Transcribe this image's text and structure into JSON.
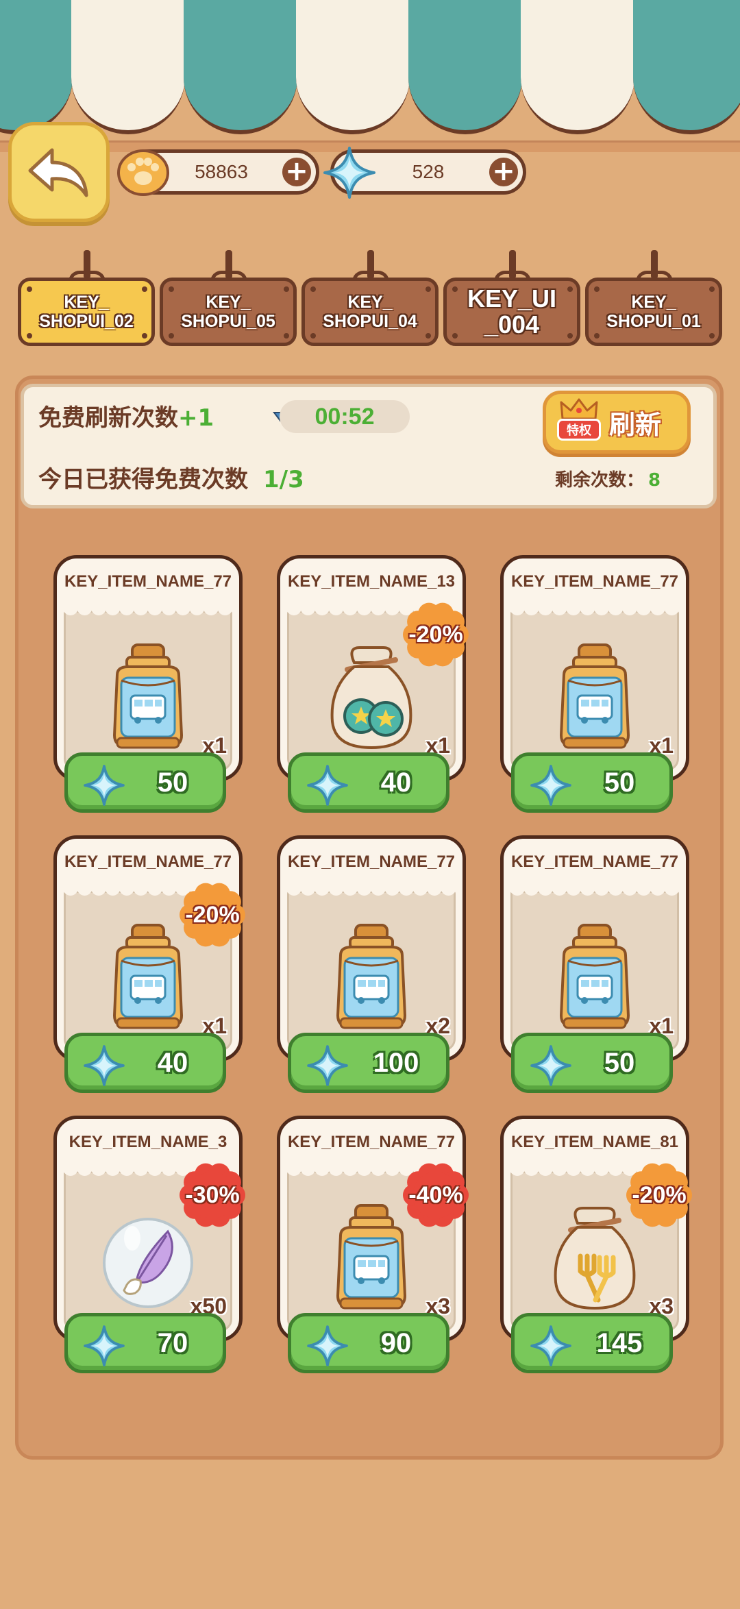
{
  "topbar": {
    "coins": "58863",
    "gems": "528"
  },
  "tabs": [
    {
      "label": "KEY_\nSHOPUI_02",
      "active": true
    },
    {
      "label": "KEY_\nSHOPUI_05",
      "active": false
    },
    {
      "label": "KEY_\nSHOPUI_04",
      "active": false
    },
    {
      "label": "KEY_UI\n_004",
      "active": false
    },
    {
      "label": "KEY_\nSHOPUI_01",
      "active": false
    }
  ],
  "info": {
    "free_refresh_label": "免费刷新次数",
    "free_refresh_bonus": "+1",
    "timer": "00:52",
    "today_label": "今日已获得免费次数",
    "today_value": "1/3",
    "remaining_label": "剩余次数：",
    "remaining_value": "8",
    "privilege_badge": "特权",
    "refresh_label": "刷新"
  },
  "items": [
    {
      "name": "KEY_ITEM_NAME_77",
      "qty": "x1",
      "price": "50",
      "discount": "",
      "icon": "bus-jar-icon"
    },
    {
      "name": "KEY_ITEM_NAME_13",
      "qty": "x1",
      "price": "40",
      "discount": "-20%",
      "icon": "coin-bag-icon"
    },
    {
      "name": "KEY_ITEM_NAME_77",
      "qty": "x1",
      "price": "50",
      "discount": "",
      "icon": "bus-jar-icon"
    },
    {
      "name": "KEY_ITEM_NAME_77",
      "qty": "x1",
      "price": "40",
      "discount": "-20%",
      "icon": "bus-jar-icon"
    },
    {
      "name": "KEY_ITEM_NAME_77",
      "qty": "x2",
      "price": "100",
      "discount": "",
      "icon": "bus-jar-icon"
    },
    {
      "name": "KEY_ITEM_NAME_77",
      "qty": "x1",
      "price": "50",
      "discount": "",
      "icon": "bus-jar-icon"
    },
    {
      "name": "KEY_ITEM_NAME_3",
      "qty": "x50",
      "price": "70",
      "discount": "-30%",
      "icon": "feather-bubble-icon"
    },
    {
      "name": "KEY_ITEM_NAME_77",
      "qty": "x3",
      "price": "90",
      "discount": "-40%",
      "icon": "bus-jar-icon"
    },
    {
      "name": "KEY_ITEM_NAME_81",
      "qty": "x3",
      "price": "145",
      "discount": "-20%",
      "icon": "fork-bag-icon"
    }
  ],
  "colors": {
    "awning_teal": "#5aa9a2",
    "awning_cream": "#f7f0e2",
    "price_green": "#79c85a",
    "discount_orange": "#f39a3a",
    "discount_red": "#e8473b"
  }
}
